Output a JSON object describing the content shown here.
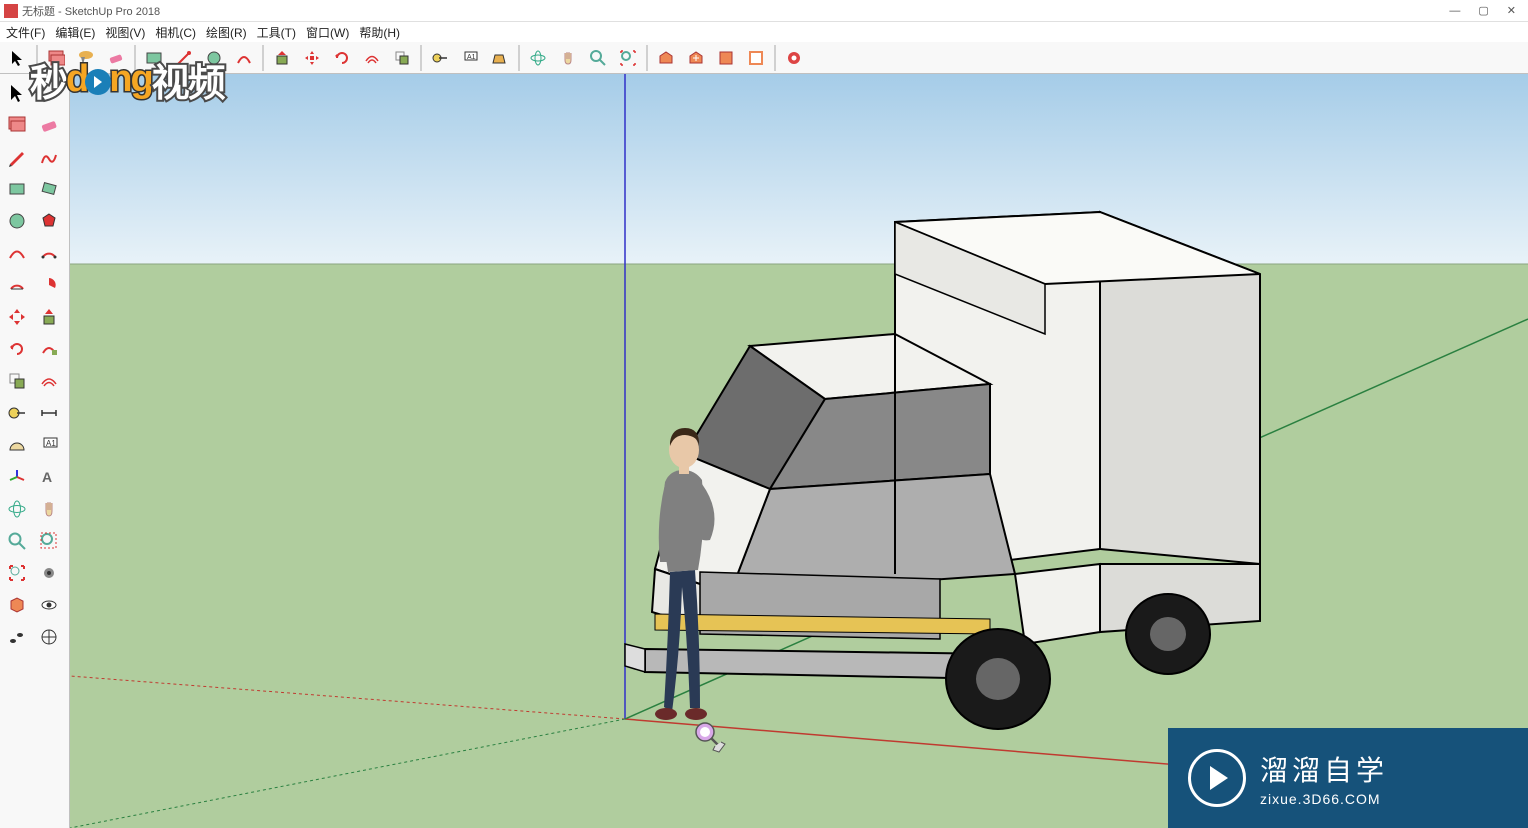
{
  "window": {
    "title": "无标题 - SketchUp Pro 2018",
    "minimize": "—",
    "maximize": "▢",
    "close": "✕"
  },
  "menu": {
    "file": "文件(F)",
    "edit": "编辑(E)",
    "view": "视图(V)",
    "camera": "相机(C)",
    "draw": "绘图(R)",
    "tools": "工具(T)",
    "window": "窗口(W)",
    "help": "帮助(H)"
  },
  "watermark_top": {
    "part1": "秒",
    "part2": "d",
    "part3": "ng",
    "part4": "视频"
  },
  "watermark_bottom": {
    "line1": "溜溜自学",
    "line2": "zixue.3D66.COM"
  },
  "top_tools": [
    "select-arrow",
    "eraser",
    "line",
    "arc",
    "shape",
    "pushpull",
    "offset",
    "move",
    "rotate",
    "scale",
    "tape",
    "text",
    "paint",
    "orbit",
    "pan",
    "zoom",
    "zoom-extents",
    "undo",
    "redo",
    "model-info",
    "3d-warehouse",
    "extension",
    "layers",
    "outliner",
    "shadows"
  ],
  "left_tools": [
    [
      "select",
      "pan-hand"
    ],
    [
      "paint-bucket",
      "eraser-soft"
    ],
    [
      "pencil",
      "freehand"
    ],
    [
      "rectangle",
      "rotated-rect"
    ],
    [
      "circle",
      "polygon"
    ],
    [
      "arc-2pt",
      "arc-3pt"
    ],
    [
      "pie",
      "polygon-shape"
    ],
    [
      "move-tool",
      "push-tool"
    ],
    [
      "rotate-tool",
      "followme"
    ],
    [
      "scale-tool",
      "offset-tool"
    ],
    [
      "tape-measure",
      "dimension"
    ],
    [
      "protractor",
      "text-tool"
    ],
    [
      "axes",
      "section"
    ],
    [
      "orbit-tool",
      "look"
    ],
    [
      "walk",
      "zoom-window"
    ],
    [
      "position-camera",
      "zoom-tool"
    ],
    [
      "prev-view",
      "zoom-ext"
    ],
    [
      "sandbox",
      "stamp"
    ],
    [
      "other1",
      "other2"
    ]
  ]
}
